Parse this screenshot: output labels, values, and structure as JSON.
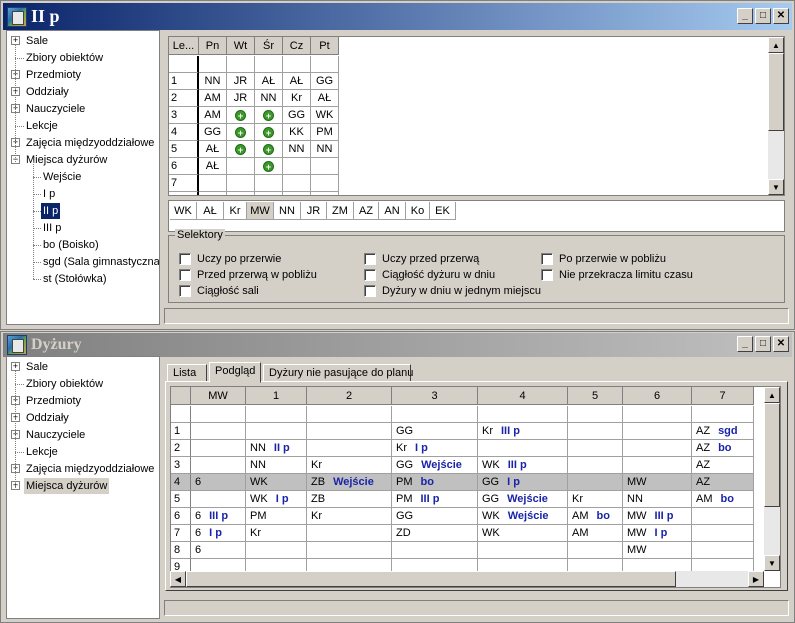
{
  "top_window": {
    "title": "II p",
    "tree": [
      {
        "label": "Sale",
        "expandable": true
      },
      {
        "label": "Zbiory obiektów",
        "expandable": false
      },
      {
        "label": "Przedmioty",
        "expandable": true
      },
      {
        "label": "Oddziały",
        "expandable": true
      },
      {
        "label": "Nauczyciele",
        "expandable": true
      },
      {
        "label": "Lekcje",
        "expandable": false
      },
      {
        "label": "Zajęcia międzyoddziałowe",
        "expandable": true
      },
      {
        "label": "Miejsca dyżurów",
        "expandable": true,
        "expanded": true
      }
    ],
    "tree_children": [
      "Wejście",
      "I p",
      "II p",
      "III p",
      "bo (Boisko)",
      "sgd (Sala gimnastyczna)",
      "st (Stołówka)"
    ],
    "tree_selected_child": "II p",
    "grid": {
      "corner": "Le...",
      "days": [
        "Pn",
        "Wt",
        "Śr",
        "Cz",
        "Pt"
      ],
      "rows": [
        {
          "n": "",
          "cells": [
            "",
            "",
            "",
            "",
            ""
          ]
        },
        {
          "n": "1",
          "cells": [
            "NN",
            "JR",
            "AŁ",
            "AŁ",
            "GG"
          ]
        },
        {
          "n": "2",
          "cells": [
            "AM",
            "JR",
            "NN",
            "Kr",
            "AŁ"
          ]
        },
        {
          "n": "3",
          "cells": [
            "AM",
            "+",
            "+",
            "GG",
            "WK"
          ]
        },
        {
          "n": "4",
          "cells": [
            "GG",
            "+",
            "+",
            "KK",
            "PM"
          ]
        },
        {
          "n": "5",
          "cells": [
            "AŁ",
            "+",
            "+",
            "NN",
            "NN"
          ]
        },
        {
          "n": "6",
          "cells": [
            "AŁ",
            "",
            "+",
            "",
            ""
          ]
        },
        {
          "n": "7",
          "cells": [
            "",
            "",
            "",
            "",
            ""
          ]
        },
        {
          "n": "8",
          "cells": [
            "",
            "",
            "",
            "",
            ""
          ]
        }
      ]
    },
    "teachers": [
      "WK",
      "AŁ",
      "Kr",
      "MW",
      "NN",
      "JR",
      "ZM",
      "AZ",
      "AN",
      "Ko",
      "EK"
    ],
    "teacher_selected": "MW",
    "selectors": {
      "legend": "Selektory",
      "items": [
        "Uczy po przerwie",
        "Uczy przed przerwą",
        "Po przerwie w pobliżu",
        "Przed przerwą w pobliżu",
        "Ciągłość dyżuru w dniu",
        "Nie przekracza limitu czasu",
        "Ciągłość sali",
        "Dyżury w dniu w jednym miejscu"
      ]
    }
  },
  "bottom_window": {
    "title": "Dyżury",
    "tree": [
      {
        "label": "Sale",
        "expandable": true
      },
      {
        "label": "Zbiory obiektów",
        "expandable": false
      },
      {
        "label": "Przedmioty",
        "expandable": true
      },
      {
        "label": "Oddziały",
        "expandable": true
      },
      {
        "label": "Nauczyciele",
        "expandable": true
      },
      {
        "label": "Lekcje",
        "expandable": false
      },
      {
        "label": "Zajęcia międzyoddziałowe",
        "expandable": true
      },
      {
        "label": "Miejsca dyżurów",
        "expandable": true
      }
    ],
    "tabs": [
      "Lista",
      "Podgląd",
      "Dyżury nie pasujące do planu"
    ],
    "active_tab": "Podgląd",
    "grid": {
      "headers": [
        "MW",
        "1",
        "2",
        "3",
        "4",
        "5",
        "6",
        "7"
      ],
      "rows": [
        {
          "n": "",
          "cells": [
            [
              "",
              ""
            ],
            [
              "",
              ""
            ],
            [
              "",
              ""
            ],
            [
              "",
              ""
            ],
            [
              "",
              ""
            ],
            [
              "",
              ""
            ],
            [
              "",
              ""
            ],
            [
              "",
              ""
            ]
          ]
        },
        {
          "n": "1",
          "cells": [
            [
              "",
              ""
            ],
            [
              "",
              ""
            ],
            [
              "",
              ""
            ],
            [
              "GG",
              ""
            ],
            [
              "Kr",
              "III p"
            ],
            [
              "",
              ""
            ],
            [
              "",
              ""
            ],
            [
              "AZ",
              "sgd"
            ]
          ]
        },
        {
          "n": "2",
          "cells": [
            [
              "",
              ""
            ],
            [
              "NN",
              "II p"
            ],
            [
              "",
              ""
            ],
            [
              "Kr",
              "I p"
            ],
            [
              "",
              ""
            ],
            [
              "",
              ""
            ],
            [
              "",
              ""
            ],
            [
              "AZ",
              "bo"
            ]
          ]
        },
        {
          "n": "3",
          "cells": [
            [
              "",
              ""
            ],
            [
              "NN",
              ""
            ],
            [
              "Kr",
              ""
            ],
            [
              "GG",
              "Wejście"
            ],
            [
              "WK",
              "III p"
            ],
            [
              "",
              ""
            ],
            [
              "",
              ""
            ],
            [
              "AZ",
              ""
            ]
          ]
        },
        {
          "n": "4",
          "cells": [
            [
              "6",
              ""
            ],
            [
              "WK",
              ""
            ],
            [
              "ZB",
              "Wejście"
            ],
            [
              "PM",
              "bo"
            ],
            [
              "GG",
              "I p"
            ],
            [
              "",
              ""
            ],
            [
              "MW",
              ""
            ],
            [
              "AZ",
              ""
            ]
          ],
          "highlight": true
        },
        {
          "n": "5",
          "cells": [
            [
              "",
              ""
            ],
            [
              "WK",
              "I p"
            ],
            [
              "ZB",
              ""
            ],
            [
              "PM",
              "III p"
            ],
            [
              "GG",
              "Wejście"
            ],
            [
              "Kr",
              ""
            ],
            [
              "NN",
              ""
            ],
            [
              "AM",
              "bo"
            ]
          ]
        },
        {
          "n": "6",
          "cells": [
            [
              "6",
              "III p"
            ],
            [
              "PM",
              ""
            ],
            [
              "Kr",
              ""
            ],
            [
              "GG",
              ""
            ],
            [
              "WK",
              "Wejście"
            ],
            [
              "AM",
              "bo"
            ],
            [
              "MW",
              "III p"
            ],
            [
              "",
              ""
            ]
          ]
        },
        {
          "n": "7",
          "cells": [
            [
              "6",
              "I p"
            ],
            [
              "Kr",
              ""
            ],
            [
              "",
              ""
            ],
            [
              "ZD",
              ""
            ],
            [
              "WK",
              ""
            ],
            [
              "AM",
              ""
            ],
            [
              "MW",
              "I p"
            ],
            [
              "",
              ""
            ]
          ]
        },
        {
          "n": "8",
          "cells": [
            [
              "6",
              ""
            ],
            [
              "",
              ""
            ],
            [
              "",
              ""
            ],
            [
              "",
              ""
            ],
            [
              "",
              ""
            ],
            [
              "",
              ""
            ],
            [
              "MW",
              ""
            ],
            [
              "",
              ""
            ]
          ]
        },
        {
          "n": "9",
          "cells": [
            [
              "",
              ""
            ],
            [
              "",
              ""
            ],
            [
              "",
              ""
            ],
            [
              "",
              ""
            ],
            [
              "",
              ""
            ],
            [
              "",
              ""
            ],
            [
              "",
              ""
            ],
            [
              "",
              ""
            ]
          ]
        }
      ]
    }
  },
  "icons": {
    "plus": "green-plus-icon",
    "minimize": "_",
    "maximize": "□",
    "close": "✕"
  }
}
